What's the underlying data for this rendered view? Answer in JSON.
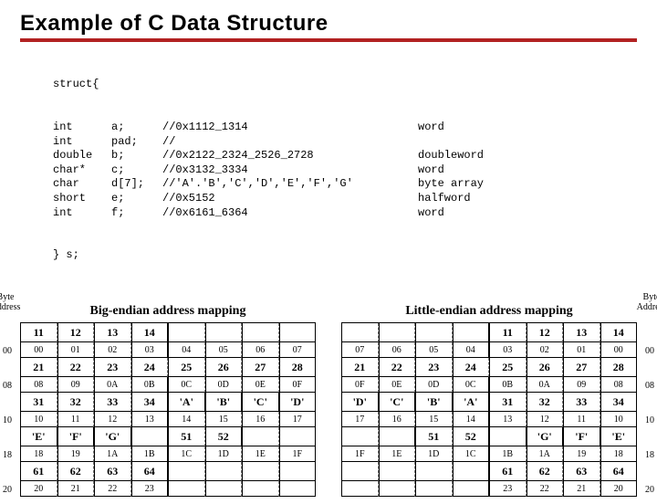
{
  "title": "Example of C Data Structure",
  "code": {
    "open": "struct{",
    "lines": [
      {
        "type": "int",
        "name": "a;",
        "comment": "//0x1112_1314",
        "ann": "word"
      },
      {
        "type": "int",
        "name": "pad;",
        "comment": "//",
        "ann": ""
      },
      {
        "type": "double",
        "name": "b;",
        "comment": "//0x2122_2324_2526_2728",
        "ann": "doubleword"
      },
      {
        "type": "char*",
        "name": "c;",
        "comment": "//0x3132_3334",
        "ann": "word"
      },
      {
        "type": "char",
        "name": "d[7];",
        "comment": "//'A'.'B','C','D','E','F','G'",
        "ann": "byte array"
      },
      {
        "type": "short",
        "name": "e;",
        "comment": "//0x5152",
        "ann": "halfword"
      },
      {
        "type": "int",
        "name": "f;",
        "comment": "//0x6161_6364",
        "ann": "word"
      }
    ],
    "close": "} s;"
  },
  "byte_addr_label": "Byte\nAddress",
  "big": {
    "title": "Big-endian address mapping",
    "rows": [
      {
        "addr": "00",
        "v": [
          "11",
          "12",
          "13",
          "14",
          "",
          "",
          "",
          ""
        ],
        "a": [
          "00",
          "01",
          "02",
          "03",
          "04",
          "05",
          "06",
          "07"
        ],
        "edges_v": [
          "d",
          "d",
          "d",
          "s",
          "d",
          "d",
          "d"
        ],
        "edges_a": [
          "d",
          "d",
          "d",
          "s",
          "d",
          "d",
          "d"
        ]
      },
      {
        "addr": "08",
        "v": [
          "21",
          "22",
          "23",
          "24",
          "25",
          "26",
          "27",
          "28"
        ],
        "a": [
          "08",
          "09",
          "0A",
          "0B",
          "0C",
          "0D",
          "0E",
          "0F"
        ],
        "edges_v": [
          "d",
          "d",
          "d",
          "d",
          "d",
          "d",
          "d"
        ],
        "edges_a": [
          "d",
          "d",
          "d",
          "s",
          "d",
          "d",
          "d"
        ]
      },
      {
        "addr": "10",
        "v": [
          "31",
          "32",
          "33",
          "34",
          "'A'",
          "'B'",
          "'C'",
          "'D'"
        ],
        "a": [
          "10",
          "11",
          "12",
          "13",
          "14",
          "15",
          "16",
          "17"
        ],
        "edges_v": [
          "d",
          "d",
          "d",
          "s",
          "s",
          "s",
          "s"
        ],
        "edges_a": [
          "d",
          "d",
          "d",
          "s",
          "d",
          "d",
          "d"
        ]
      },
      {
        "addr": "18",
        "v": [
          "'E'",
          "'F'",
          "'G'",
          "",
          "51",
          "52",
          "",
          ""
        ],
        "a": [
          "18",
          "19",
          "1A",
          "1B",
          "1C",
          "1D",
          "1E",
          "1F"
        ],
        "edges_v": [
          "s",
          "s",
          "s",
          "s",
          "d",
          "s",
          "d"
        ],
        "edges_a": [
          "d",
          "d",
          "d",
          "s",
          "d",
          "d",
          "d"
        ]
      },
      {
        "addr": "20",
        "v": [
          "61",
          "62",
          "63",
          "64",
          "",
          "",
          "",
          ""
        ],
        "a": [
          "20",
          "21",
          "22",
          "23",
          "",
          "",
          "",
          ""
        ],
        "edges_v": [
          "d",
          "d",
          "d",
          "s",
          "d",
          "d",
          "d"
        ],
        "edges_a": [
          "d",
          "d",
          "d",
          "s",
          "d",
          "d",
          "d"
        ]
      }
    ]
  },
  "little": {
    "title": "Little-endian address mapping",
    "rows": [
      {
        "addr": "00",
        "v": [
          "",
          "",
          "",
          "",
          "11",
          "12",
          "13",
          "14"
        ],
        "a": [
          "07",
          "06",
          "05",
          "04",
          "03",
          "02",
          "01",
          "00"
        ],
        "edges_v": [
          "d",
          "d",
          "d",
          "s",
          "d",
          "d",
          "d"
        ],
        "edges_a": [
          "d",
          "d",
          "d",
          "s",
          "d",
          "d",
          "d"
        ]
      },
      {
        "addr": "08",
        "v": [
          "21",
          "22",
          "23",
          "24",
          "25",
          "26",
          "27",
          "28"
        ],
        "a": [
          "0F",
          "0E",
          "0D",
          "0C",
          "0B",
          "0A",
          "09",
          "08"
        ],
        "edges_v": [
          "d",
          "d",
          "d",
          "d",
          "d",
          "d",
          "d"
        ],
        "edges_a": [
          "d",
          "d",
          "d",
          "s",
          "d",
          "d",
          "d"
        ]
      },
      {
        "addr": "10",
        "v": [
          "'D'",
          "'C'",
          "'B'",
          "'A'",
          "31",
          "32",
          "33",
          "34"
        ],
        "a": [
          "17",
          "16",
          "15",
          "14",
          "13",
          "12",
          "11",
          "10"
        ],
        "edges_v": [
          "s",
          "s",
          "s",
          "s",
          "d",
          "d",
          "d"
        ],
        "edges_a": [
          "d",
          "d",
          "d",
          "s",
          "d",
          "d",
          "d"
        ]
      },
      {
        "addr": "18",
        "v": [
          "",
          "",
          "51",
          "52",
          "",
          "'G'",
          "'F'",
          "'E'"
        ],
        "a": [
          "1F",
          "1E",
          "1D",
          "1C",
          "1B",
          "1A",
          "19",
          "18"
        ],
        "edges_v": [
          "d",
          "s",
          "d",
          "s",
          "s",
          "s",
          "s"
        ],
        "edges_a": [
          "d",
          "d",
          "d",
          "s",
          "d",
          "d",
          "d"
        ]
      },
      {
        "addr": "20",
        "v": [
          "",
          "",
          "",
          "",
          "61",
          "62",
          "63",
          "64"
        ],
        "a": [
          "",
          "",
          "",
          "",
          "23",
          "22",
          "21",
          "20"
        ],
        "edges_v": [
          "d",
          "d",
          "d",
          "s",
          "d",
          "d",
          "d"
        ],
        "edges_a": [
          "d",
          "d",
          "d",
          "s",
          "d",
          "d",
          "d"
        ]
      }
    ]
  }
}
